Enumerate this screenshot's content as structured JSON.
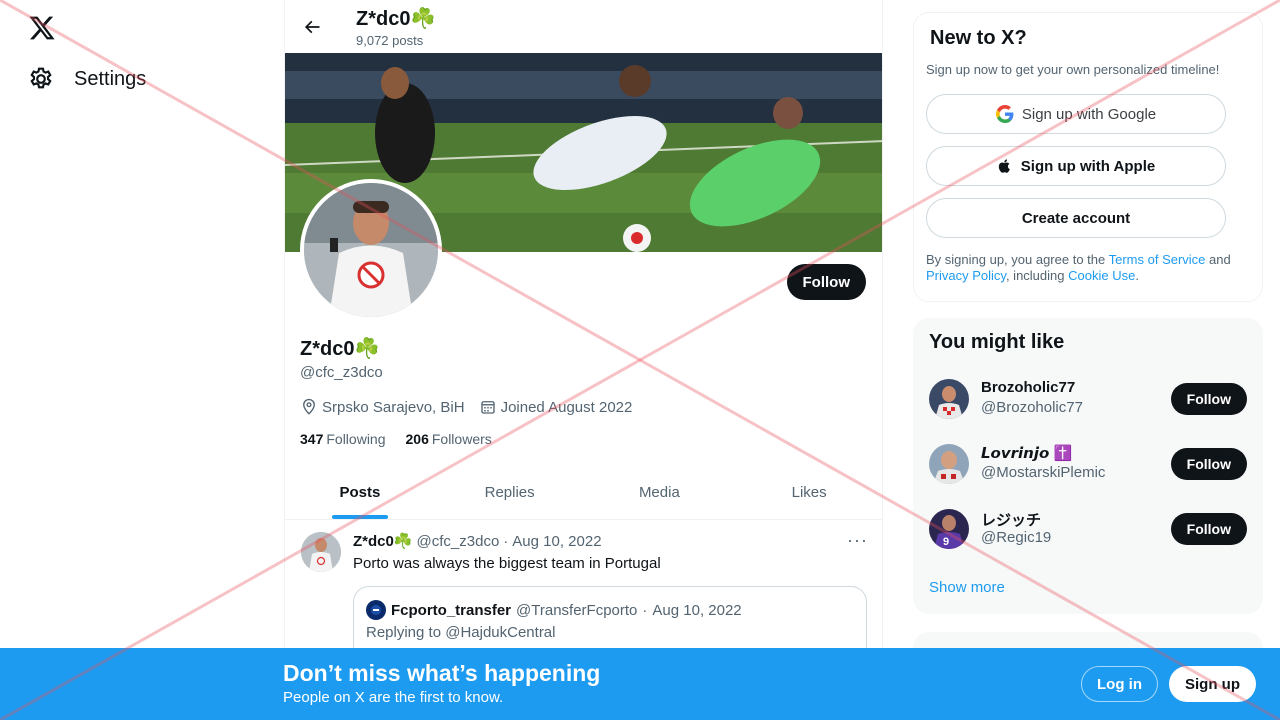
{
  "nav": {
    "settings_label": "Settings"
  },
  "header": {
    "name": "Z*dc0☘️",
    "posts_count": "9,072 posts"
  },
  "profile": {
    "name": "Z*dc0☘️",
    "handle": "@cfc_z3dco",
    "location": "Srpsko Sarajevo, BiH",
    "joined": "Joined August 2022",
    "following_count": "347",
    "following_label": "Following",
    "followers_count": "206",
    "followers_label": "Followers",
    "follow_label": "Follow"
  },
  "tabs": [
    {
      "label": "Posts"
    },
    {
      "label": "Replies"
    },
    {
      "label": "Media"
    },
    {
      "label": "Likes"
    }
  ],
  "post": {
    "name": "Z*dc0☘️",
    "handle": "@cfc_z3dco",
    "separator": "·",
    "date": "Aug 10, 2022",
    "more": "···",
    "text": "Porto was always the biggest team in Portugal",
    "quote": {
      "name": "Fcporto_transfer",
      "handle": "@TransferFcporto",
      "separator": "·",
      "date": "Aug 10, 2022",
      "replying": "Replying to @HajdukCentral"
    }
  },
  "new_to_x": {
    "title": "New to X?",
    "subtitle": "Sign up now to get your own personalized timeline!",
    "google_label": "Sign up with Google",
    "apple_label": "Sign up with Apple",
    "create_label": "Create account",
    "legal_prefix": "By signing up, you agree to the ",
    "terms": "Terms of Service",
    "legal_and": " and ",
    "privacy": "Privacy Policy",
    "legal_including": ", including ",
    "cookie": "Cookie Use",
    "legal_end": "."
  },
  "might_like": {
    "title": "You might like",
    "users": [
      {
        "name": "Brozoholic77",
        "handle": "@Brozoholic77",
        "follow": "Follow"
      },
      {
        "name": "𝙇𝙤𝙫𝙧𝙞𝙣𝙟𝙤 ✝️",
        "handle": "@MostarskiPlemic",
        "follow": "Follow"
      },
      {
        "name": "レジッチ",
        "handle": "@Regic19",
        "follow": "Follow"
      }
    ],
    "show_more": "Show more"
  },
  "bottom_bar": {
    "title": "Don’t miss what’s happening",
    "subtitle": "People on X are the first to know.",
    "login": "Log in",
    "signup": "Sign up"
  },
  "colors": {
    "accent": "#1d9bf0",
    "text": "#0f1419",
    "secondary": "#536471",
    "overlay_cross": "#e8505b"
  }
}
